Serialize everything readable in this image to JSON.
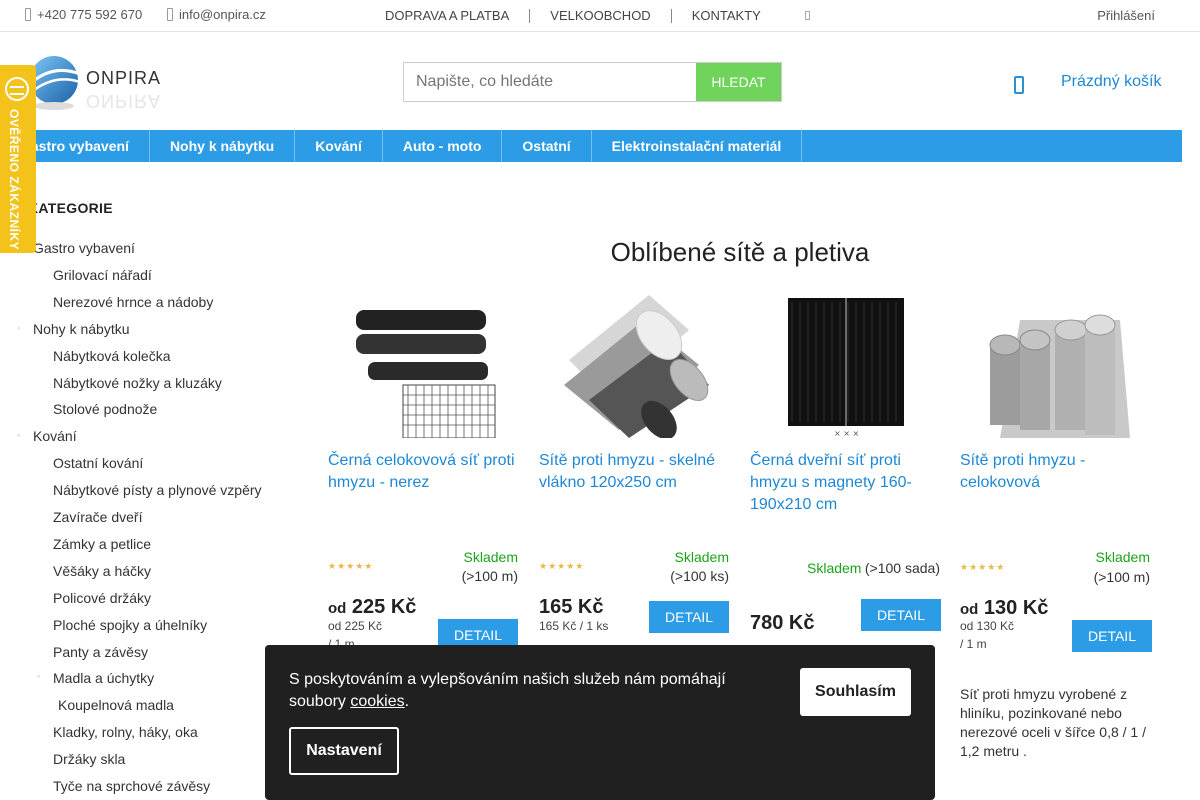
{
  "topbar": {
    "phone": "+420 775 592 670",
    "email": "info@onpira.cz",
    "nav": [
      "DOPRAVA A PLATBA",
      "VELKOOBCHOD",
      "KONTAKTY"
    ],
    "login": "Přihlášení"
  },
  "header": {
    "logo_text": "ONPIRA",
    "search_placeholder": "Napište, co hledáte",
    "search_button": "HLEDAT",
    "cart": "Prázdný košík"
  },
  "mainnav": [
    "Gastro vybavení",
    "Nohy k nábytku",
    "Kování",
    "Auto - moto",
    "Ostatní",
    "Elektroinstalační materiál"
  ],
  "badge": "OVĚŘENO ZÁKAZNÍKY",
  "sidebar": {
    "title": "KATEGORIE",
    "items": [
      {
        "label": "Gastro vybavení",
        "level": 1
      },
      {
        "label": "Grilovací nářadí",
        "level": 2
      },
      {
        "label": "Nerezové hrnce a nádoby",
        "level": 2
      },
      {
        "label": "Nohy k nábytku",
        "level": 1
      },
      {
        "label": "Nábytková kolečka",
        "level": 2
      },
      {
        "label": "Nábytkové nožky a kluzáky",
        "level": 2
      },
      {
        "label": "Stolové podnože",
        "level": 2
      },
      {
        "label": "Kování",
        "level": 1
      },
      {
        "label": "Ostatní kování",
        "level": 2
      },
      {
        "label": "Nábytkové písty a plynové vzpěry",
        "level": 2
      },
      {
        "label": "Zavírače dveří",
        "level": 2
      },
      {
        "label": "Zámky a petlice",
        "level": 2
      },
      {
        "label": "Věšáky a háčky",
        "level": 2
      },
      {
        "label": "Policové držáky",
        "level": 2
      },
      {
        "label": "Ploché spojky a úhelníky",
        "level": 2
      },
      {
        "label": "Panty a závěsy",
        "level": 2
      },
      {
        "label": "Madla a úchytky",
        "level": 2
      },
      {
        "label": "Koupelnová madla",
        "level": 3
      },
      {
        "label": "Kladky, rolny, háky, oka",
        "level": 2
      },
      {
        "label": "Držáky skla",
        "level": 2
      },
      {
        "label": "Tyče na sprchové závěsy",
        "level": 2
      }
    ]
  },
  "content": {
    "title": "Oblíbené sítě a pletiva",
    "products": [
      {
        "name": "Černá celokovová síť proti hmyzu - nerez",
        "stock": "Skladem",
        "stock_qty": "(>100 m)",
        "price_prefix": "od",
        "price": "225 Kč",
        "price_sub": "od 225 Kč",
        "price_unit": "/ 1 m",
        "detail": "DETAIL"
      },
      {
        "name": "Sítě proti hmyzu - skelné vlákno 120x250 cm",
        "stock": "Skladem",
        "stock_qty": "(>100 ks)",
        "price_prefix": "",
        "price": "165 Kč",
        "price_sub": "165 Kč / 1 ks",
        "price_unit": "",
        "detail": "DETAIL"
      },
      {
        "name": "Černá dveřní síť proti hmyzu s magnety 160-190x210 cm",
        "stock": "Skladem",
        "stock_qty": "(>100 sada)",
        "price_prefix": "",
        "price": "780 Kč",
        "price_sub": "",
        "price_unit": "",
        "detail": "DETAIL"
      },
      {
        "name": "Sítě proti hmyzu - celokovová",
        "stock": "Skladem",
        "stock_qty": "(>100 m)",
        "price_prefix": "od",
        "price": "130 Kč",
        "price_sub": "od 130 Kč",
        "price_unit": "/ 1 m",
        "detail": "DETAIL",
        "description": "Síť proti hmyzu vyrobené z hliníku, pozinkované nebo nerezové oceli v šířce 0,8 / 1 / 1,2 metru ."
      }
    ]
  },
  "cookie": {
    "text_before": "S poskytováním a vylepšováním našich služeb nám pomáhají soubory ",
    "link": "cookies",
    "text_after": ".",
    "agree": "Souhlasím",
    "settings": "Nastavení"
  },
  "colors": {
    "accent_blue": "#2d9ce6",
    "search_green": "#6fd35c",
    "stock_green": "#1aa31a",
    "badge_yellow": "#f3c21b"
  }
}
